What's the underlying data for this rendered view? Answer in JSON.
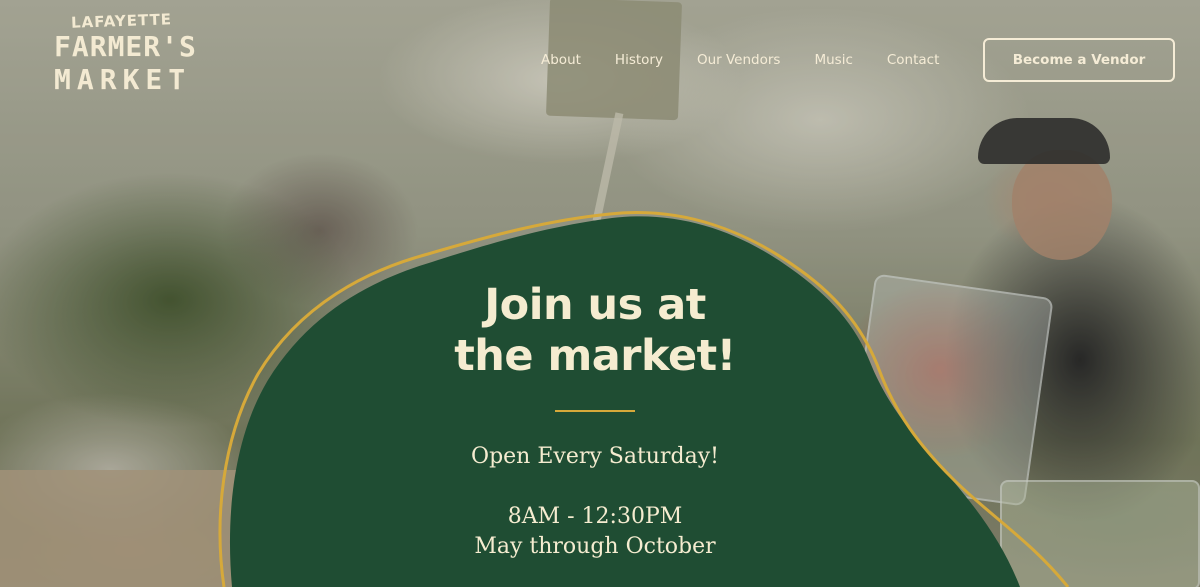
{
  "logo": {
    "top": "LAFAYETTE",
    "line1": "FARMER'S",
    "line2": "MARKET"
  },
  "nav": {
    "items": [
      "About",
      "History",
      "Our Vendors",
      "Music",
      "Contact"
    ],
    "cta": "Become a Vendor"
  },
  "hero": {
    "title_line1": "Join us at",
    "title_line2": "the market!",
    "days": "Open Every Saturday!",
    "hours": "8AM - 12:30PM",
    "season": "May through October"
  },
  "colors": {
    "blob_green": "#1f4d33",
    "accent_gold": "#d6a93a",
    "cream_text": "#f5ecd0"
  }
}
